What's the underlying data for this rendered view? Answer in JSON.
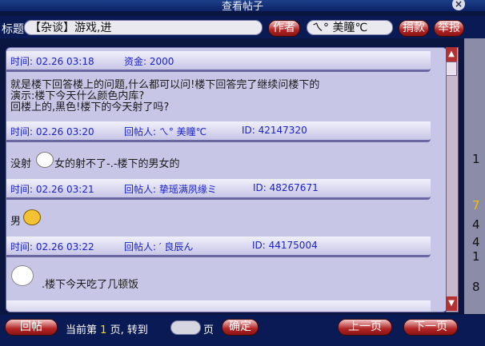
{
  "window": {
    "title": "查看帖子",
    "close_symbol": "×"
  },
  "header": {
    "title_label": "标题",
    "title_value": "【杂谈】游戏,进",
    "author_button": "作者",
    "author_value": "ㄟ° 美瞳℃",
    "donate_button": "捐款",
    "report_button": "举报"
  },
  "posts": [
    {
      "time": "时间: 02.26 03:18",
      "extra": "资金: 2000",
      "body": [
        "就是楼下回答楼上的问题,什么都可以问!楼下回答完了继续问楼下的",
        "演示:楼下今天什么颜色内库?",
        "回楼上的,黑色!楼下的今天射了吗?"
      ]
    },
    {
      "time": "时间: 02.26 03:20",
      "replier": "回帖人: ㄟ° 美瞳℃",
      "id": "ID: 42147320",
      "body": [
        "没射",
        "女的射不了-.-楼下的男女的"
      ]
    },
    {
      "time": "时间: 02.26 03:21",
      "replier": "回帖人: 挚瑶满夙缘ミ",
      "id": "ID: 48267671",
      "body": [
        "男"
      ]
    },
    {
      "time": "时间: 02.26 03:22",
      "replier": "回帖人: ′ 良辰ん",
      "id": "ID: 44175004",
      "body": [
        ".楼下今天吃了几顿饭"
      ]
    }
  ],
  "right_strip_numbers": [
    "1",
    "7",
    "4",
    "4",
    "1",
    "8"
  ],
  "footer": {
    "reply_button": "回帖",
    "page_prefix": "当前第",
    "page_number": "1",
    "page_suffix": "页, 转到",
    "page_unit": "页",
    "go_button": "确定",
    "prev_button": "上一页",
    "next_button": "下一页"
  },
  "colors": {
    "meta_text": "#1a22c8",
    "button_red": "#b32424",
    "panel_bg": "#c8c6e6"
  },
  "icons": [
    "close-icon",
    "scroll-up-icon",
    "scroll-down-icon",
    "emote-icon"
  ]
}
